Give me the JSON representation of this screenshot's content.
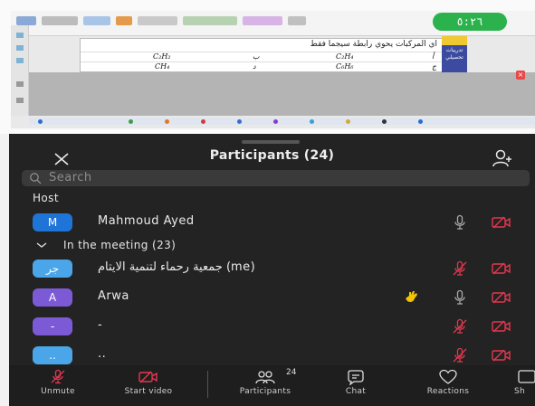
{
  "timer": "٥:٢٦",
  "slide": {
    "question": "اي المركبات يحوي رابطة سيجما فقط",
    "rows": [
      {
        "left": "C₂H₂",
        "mid": "ب",
        "right": "C₂H₄",
        "idx": "أ"
      },
      {
        "left": "CH₄",
        "mid": "د",
        "right": "C₆H₆",
        "idx": "ج"
      }
    ],
    "side_card": "تدريبات تحصيلي"
  },
  "panel": {
    "title": "Participants (24)",
    "search_placeholder": "Search",
    "host_label": "Host",
    "meeting_label": "In the meeting (23)"
  },
  "participants": [
    {
      "initial": "M",
      "name": "Mahmoud Ayed",
      "avatar_color": "#1f74d8",
      "mic": "on",
      "video": "off",
      "hand": false
    },
    {
      "initial": "جر",
      "name": "جمعية رحماء لتنمية الايتام (me)",
      "avatar_color": "#4aa6e8",
      "mic": "off",
      "video": "off",
      "hand": false
    },
    {
      "initial": "A",
      "name": "Arwa",
      "avatar_color": "#7c5ad6",
      "mic": "on",
      "video": "off",
      "hand": true
    },
    {
      "initial": "-",
      "name": "-",
      "avatar_color": "#7c5ad6",
      "mic": "off",
      "video": "off",
      "hand": false
    },
    {
      "initial": "..",
      "name": "..",
      "avatar_color": "#4aa6e8",
      "mic": "off",
      "video": "off",
      "hand": false
    }
  ],
  "toolbar": {
    "unmute": "Unmute",
    "start_video": "Start video",
    "participants": "Participants",
    "participants_count": "24",
    "chat": "Chat",
    "reactions": "Reactions",
    "share": "Sh"
  },
  "colors": {
    "accent_red": "#e2384f",
    "timer_green": "#2bb24c",
    "hand_yellow": "#f5c400"
  }
}
